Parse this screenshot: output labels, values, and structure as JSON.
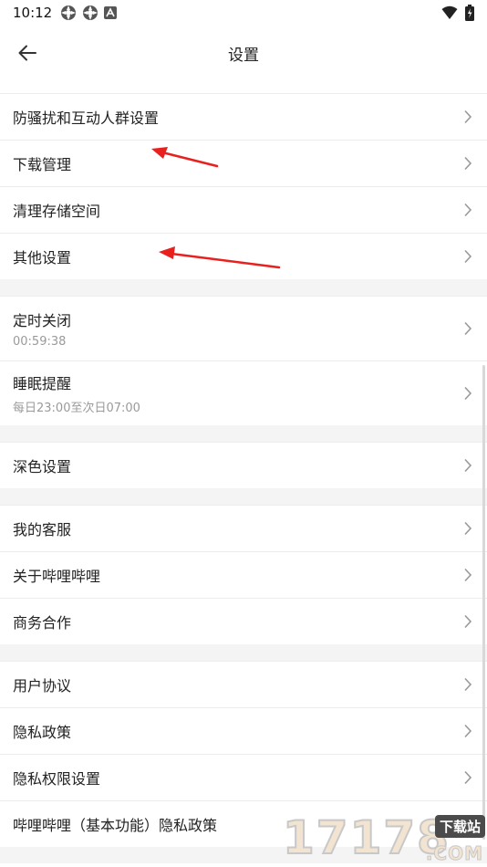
{
  "status_bar": {
    "time": "10:12",
    "left_icons": [
      "app-notification-icon",
      "app-notification-icon",
      "a-notification-icon"
    ],
    "right_icons": [
      "wifi-icon",
      "battery-icon"
    ]
  },
  "app_bar": {
    "title": "设置",
    "back_icon": "arrow-left-icon"
  },
  "sections": [
    {
      "items": [
        {
          "label": "防骚扰和互动人群设置"
        },
        {
          "label": "下载管理"
        },
        {
          "label": "清理存储空间"
        },
        {
          "label": "其他设置"
        }
      ]
    },
    {
      "items": [
        {
          "label": "定时关闭",
          "sub": "00:59:38"
        },
        {
          "label": "睡眠提醒",
          "sub": "每日23:00至次日07:00"
        }
      ]
    },
    {
      "items": [
        {
          "label": "深色设置"
        }
      ]
    },
    {
      "items": [
        {
          "label": "我的客服"
        },
        {
          "label": "关于哔哩哔哩"
        },
        {
          "label": "商务合作"
        }
      ]
    },
    {
      "items": [
        {
          "label": "用户协议"
        },
        {
          "label": "隐私政策"
        },
        {
          "label": "隐私权限设置"
        },
        {
          "label": "哔哩哔哩（基本功能）隐私政策"
        }
      ]
    }
  ],
  "annotation_color": "#e8211f",
  "watermark": {
    "number": "17178",
    "tag": "下载站",
    "domain": ".COM"
  }
}
